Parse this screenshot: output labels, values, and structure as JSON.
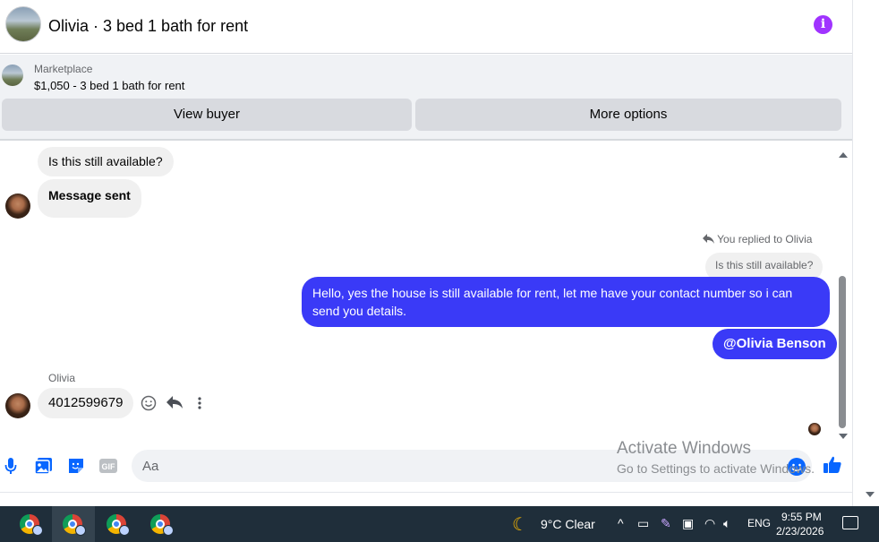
{
  "header": {
    "title": "Olivia · 3 bed 1 bath for rent",
    "info_icon": "info-icon"
  },
  "listing": {
    "source": "Marketplace",
    "title": "$1,050 - 3 bed 1 bath for rent",
    "view_buyer_label": "View buyer",
    "more_options_label": "More options"
  },
  "messages": {
    "incoming_1": "Is this still available?",
    "incoming_2": "Message sent",
    "replied_to": "You replied to Olivia",
    "quoted": "Is this still available?",
    "outgoing_1": "Hello, yes the house is still available for rent, let me have your contact number so i can send you details.",
    "outgoing_2": "@Olivia Benson",
    "sender_name": "Olivia",
    "incoming_3": "4012599679"
  },
  "composer": {
    "placeholder": "Aa",
    "icons": [
      "microphone-icon",
      "photo-icon",
      "sticker-icon",
      "gif-icon",
      "emoji-icon",
      "like-icon"
    ]
  },
  "watermark": {
    "line1": "Activate Windows",
    "line2": "Go to Settings to activate Windows."
  },
  "taskbar": {
    "weather": "9°C  Clear",
    "language": "ENG",
    "time": "9:55 PM",
    "date": "2/23/2026"
  },
  "colors": {
    "accent": "#3a3af7",
    "info": "#a033ff",
    "icon_blue": "#0866ff",
    "taskbar": "#1f2e3a"
  }
}
